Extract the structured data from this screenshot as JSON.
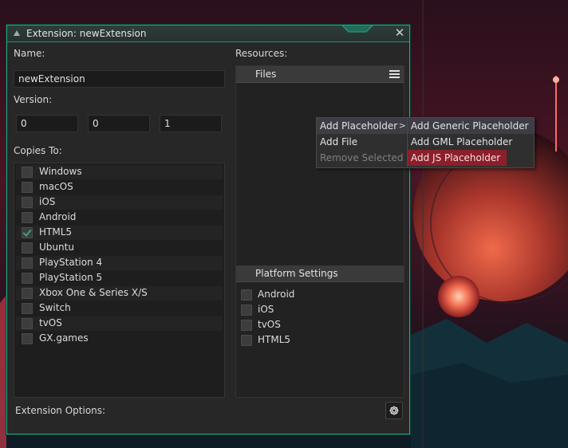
{
  "window": {
    "title": "Extension: newExtension",
    "close_glyph": "✕"
  },
  "name": {
    "label": "Name:",
    "value": "newExtension"
  },
  "version": {
    "label": "Version:",
    "major": "0",
    "minor": "0",
    "patch": "1"
  },
  "copies_to": {
    "label": "Copies To:",
    "items": [
      {
        "label": "Windows",
        "checked": false
      },
      {
        "label": "macOS",
        "checked": false
      },
      {
        "label": "iOS",
        "checked": false
      },
      {
        "label": "Android",
        "checked": false
      },
      {
        "label": "HTML5",
        "checked": true
      },
      {
        "label": "Ubuntu",
        "checked": false
      },
      {
        "label": "PlayStation 4",
        "checked": false
      },
      {
        "label": "PlayStation 5",
        "checked": false
      },
      {
        "label": "Xbox One & Series X/S",
        "checked": false
      },
      {
        "label": "Switch",
        "checked": false
      },
      {
        "label": "tvOS",
        "checked": false
      },
      {
        "label": "GX.games",
        "checked": false
      }
    ]
  },
  "resources": {
    "label": "Resources:",
    "files_header": "Files",
    "platform_header": "Platform Settings",
    "platforms": [
      {
        "label": "Android",
        "checked": false
      },
      {
        "label": "iOS",
        "checked": false
      },
      {
        "label": "tvOS",
        "checked": false
      },
      {
        "label": "HTML5",
        "checked": false
      }
    ]
  },
  "extension_options": {
    "label": "Extension Options:",
    "icon": "gear-icon"
  },
  "context_menu": {
    "items": [
      {
        "label": "Add Placeholder",
        "submenu": true
      },
      {
        "label": "Add File"
      },
      {
        "label": "Remove Selected",
        "disabled": true
      }
    ],
    "submenu": [
      {
        "label": "Add Generic Placeholder"
      },
      {
        "label": "Add GML Placeholder"
      },
      {
        "label": "Add JS Placeholder"
      }
    ]
  },
  "colors": {
    "accent": "#2aa386",
    "highlight": "#8b1f2b",
    "check": "#3ea27a"
  }
}
